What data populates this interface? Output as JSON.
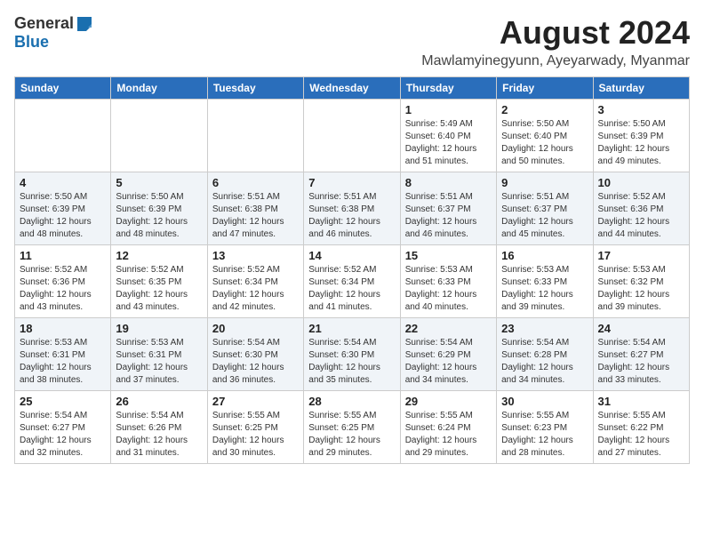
{
  "header": {
    "logo_general": "General",
    "logo_blue": "Blue",
    "main_title": "August 2024",
    "subtitle": "Mawlamyinegyunn, Ayeyarwady, Myanmar"
  },
  "weekdays": [
    "Sunday",
    "Monday",
    "Tuesday",
    "Wednesday",
    "Thursday",
    "Friday",
    "Saturday"
  ],
  "weeks": [
    [
      {
        "day": "",
        "content": ""
      },
      {
        "day": "",
        "content": ""
      },
      {
        "day": "",
        "content": ""
      },
      {
        "day": "",
        "content": ""
      },
      {
        "day": "1",
        "content": "Sunrise: 5:49 AM\nSunset: 6:40 PM\nDaylight: 12 hours\nand 51 minutes."
      },
      {
        "day": "2",
        "content": "Sunrise: 5:50 AM\nSunset: 6:40 PM\nDaylight: 12 hours\nand 50 minutes."
      },
      {
        "day": "3",
        "content": "Sunrise: 5:50 AM\nSunset: 6:39 PM\nDaylight: 12 hours\nand 49 minutes."
      }
    ],
    [
      {
        "day": "4",
        "content": "Sunrise: 5:50 AM\nSunset: 6:39 PM\nDaylight: 12 hours\nand 48 minutes."
      },
      {
        "day": "5",
        "content": "Sunrise: 5:50 AM\nSunset: 6:39 PM\nDaylight: 12 hours\nand 48 minutes."
      },
      {
        "day": "6",
        "content": "Sunrise: 5:51 AM\nSunset: 6:38 PM\nDaylight: 12 hours\nand 47 minutes."
      },
      {
        "day": "7",
        "content": "Sunrise: 5:51 AM\nSunset: 6:38 PM\nDaylight: 12 hours\nand 46 minutes."
      },
      {
        "day": "8",
        "content": "Sunrise: 5:51 AM\nSunset: 6:37 PM\nDaylight: 12 hours\nand 46 minutes."
      },
      {
        "day": "9",
        "content": "Sunrise: 5:51 AM\nSunset: 6:37 PM\nDaylight: 12 hours\nand 45 minutes."
      },
      {
        "day": "10",
        "content": "Sunrise: 5:52 AM\nSunset: 6:36 PM\nDaylight: 12 hours\nand 44 minutes."
      }
    ],
    [
      {
        "day": "11",
        "content": "Sunrise: 5:52 AM\nSunset: 6:36 PM\nDaylight: 12 hours\nand 43 minutes."
      },
      {
        "day": "12",
        "content": "Sunrise: 5:52 AM\nSunset: 6:35 PM\nDaylight: 12 hours\nand 43 minutes."
      },
      {
        "day": "13",
        "content": "Sunrise: 5:52 AM\nSunset: 6:34 PM\nDaylight: 12 hours\nand 42 minutes."
      },
      {
        "day": "14",
        "content": "Sunrise: 5:52 AM\nSunset: 6:34 PM\nDaylight: 12 hours\nand 41 minutes."
      },
      {
        "day": "15",
        "content": "Sunrise: 5:53 AM\nSunset: 6:33 PM\nDaylight: 12 hours\nand 40 minutes."
      },
      {
        "day": "16",
        "content": "Sunrise: 5:53 AM\nSunset: 6:33 PM\nDaylight: 12 hours\nand 39 minutes."
      },
      {
        "day": "17",
        "content": "Sunrise: 5:53 AM\nSunset: 6:32 PM\nDaylight: 12 hours\nand 39 minutes."
      }
    ],
    [
      {
        "day": "18",
        "content": "Sunrise: 5:53 AM\nSunset: 6:31 PM\nDaylight: 12 hours\nand 38 minutes."
      },
      {
        "day": "19",
        "content": "Sunrise: 5:53 AM\nSunset: 6:31 PM\nDaylight: 12 hours\nand 37 minutes."
      },
      {
        "day": "20",
        "content": "Sunrise: 5:54 AM\nSunset: 6:30 PM\nDaylight: 12 hours\nand 36 minutes."
      },
      {
        "day": "21",
        "content": "Sunrise: 5:54 AM\nSunset: 6:30 PM\nDaylight: 12 hours\nand 35 minutes."
      },
      {
        "day": "22",
        "content": "Sunrise: 5:54 AM\nSunset: 6:29 PM\nDaylight: 12 hours\nand 34 minutes."
      },
      {
        "day": "23",
        "content": "Sunrise: 5:54 AM\nSunset: 6:28 PM\nDaylight: 12 hours\nand 34 minutes."
      },
      {
        "day": "24",
        "content": "Sunrise: 5:54 AM\nSunset: 6:27 PM\nDaylight: 12 hours\nand 33 minutes."
      }
    ],
    [
      {
        "day": "25",
        "content": "Sunrise: 5:54 AM\nSunset: 6:27 PM\nDaylight: 12 hours\nand 32 minutes."
      },
      {
        "day": "26",
        "content": "Sunrise: 5:54 AM\nSunset: 6:26 PM\nDaylight: 12 hours\nand 31 minutes."
      },
      {
        "day": "27",
        "content": "Sunrise: 5:55 AM\nSunset: 6:25 PM\nDaylight: 12 hours\nand 30 minutes."
      },
      {
        "day": "28",
        "content": "Sunrise: 5:55 AM\nSunset: 6:25 PM\nDaylight: 12 hours\nand 29 minutes."
      },
      {
        "day": "29",
        "content": "Sunrise: 5:55 AM\nSunset: 6:24 PM\nDaylight: 12 hours\nand 29 minutes."
      },
      {
        "day": "30",
        "content": "Sunrise: 5:55 AM\nSunset: 6:23 PM\nDaylight: 12 hours\nand 28 minutes."
      },
      {
        "day": "31",
        "content": "Sunrise: 5:55 AM\nSunset: 6:22 PM\nDaylight: 12 hours\nand 27 minutes."
      }
    ]
  ]
}
